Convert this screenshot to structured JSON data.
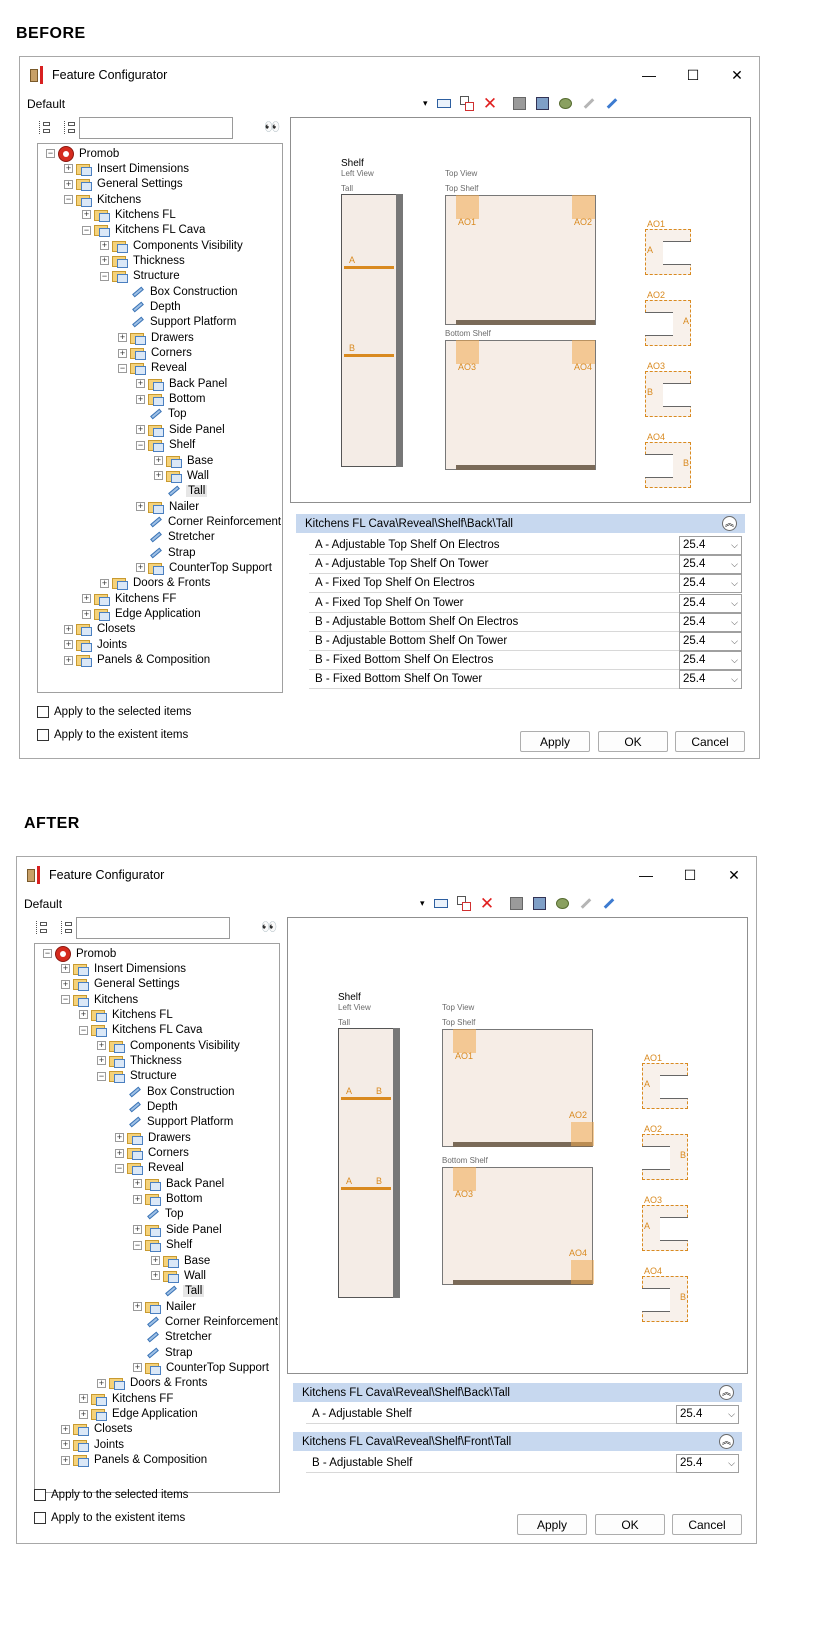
{
  "headings": {
    "before": "BEFORE",
    "after": "AFTER"
  },
  "window": {
    "title": "Feature Configurator",
    "controls": {
      "minimize": "—",
      "maximize": "☐",
      "close": "✕"
    }
  },
  "toolbar": {
    "profile": "Default",
    "dropdown_arrow": "▾"
  },
  "tree": {
    "search_icon": "👀",
    "rows": [
      {
        "label": "Promob",
        "depth": 0,
        "expander": "−",
        "icon": "root"
      },
      {
        "label": "Insert Dimensions",
        "depth": 1,
        "expander": "+",
        "icon": "folder"
      },
      {
        "label": "General Settings",
        "depth": 1,
        "expander": "+",
        "icon": "folder"
      },
      {
        "label": "Kitchens",
        "depth": 1,
        "expander": "−",
        "icon": "folder"
      },
      {
        "label": "Kitchens FL",
        "depth": 2,
        "expander": "+",
        "icon": "folder"
      },
      {
        "label": "Kitchens FL Cava",
        "depth": 2,
        "expander": "−",
        "icon": "folder"
      },
      {
        "label": "Components Visibility",
        "depth": 3,
        "expander": "+",
        "icon": "folder"
      },
      {
        "label": "Thickness",
        "depth": 3,
        "expander": "+",
        "icon": "folder"
      },
      {
        "label": "Structure",
        "depth": 3,
        "expander": "−",
        "icon": "folder"
      },
      {
        "label": "Box Construction",
        "depth": 4,
        "expander": "",
        "icon": "leaf"
      },
      {
        "label": "Depth",
        "depth": 4,
        "expander": "",
        "icon": "leaf"
      },
      {
        "label": "Support Platform",
        "depth": 4,
        "expander": "",
        "icon": "leaf"
      },
      {
        "label": "Drawers",
        "depth": 4,
        "expander": "+",
        "icon": "folder"
      },
      {
        "label": "Corners",
        "depth": 4,
        "expander": "+",
        "icon": "folder"
      },
      {
        "label": "Reveal",
        "depth": 4,
        "expander": "−",
        "icon": "folder"
      },
      {
        "label": "Back Panel",
        "depth": 5,
        "expander": "+",
        "icon": "folder"
      },
      {
        "label": "Bottom",
        "depth": 5,
        "expander": "+",
        "icon": "folder"
      },
      {
        "label": "Top",
        "depth": 5,
        "expander": "",
        "icon": "leaf"
      },
      {
        "label": "Side Panel",
        "depth": 5,
        "expander": "+",
        "icon": "folder"
      },
      {
        "label": "Shelf",
        "depth": 5,
        "expander": "−",
        "icon": "folder"
      },
      {
        "label": "Base",
        "depth": 6,
        "expander": "+",
        "icon": "folder"
      },
      {
        "label": "Wall",
        "depth": 6,
        "expander": "+",
        "icon": "folder"
      },
      {
        "label": "Tall",
        "depth": 6,
        "expander": "",
        "icon": "leaf",
        "selected": true
      },
      {
        "label": "Nailer",
        "depth": 5,
        "expander": "+",
        "icon": "folder"
      },
      {
        "label": "Corner Reinforcement",
        "depth": 5,
        "expander": "",
        "icon": "leaf"
      },
      {
        "label": "Stretcher",
        "depth": 5,
        "expander": "",
        "icon": "leaf"
      },
      {
        "label": "Strap",
        "depth": 5,
        "expander": "",
        "icon": "leaf"
      },
      {
        "label": "CounterTop Support",
        "depth": 5,
        "expander": "+",
        "icon": "folder"
      },
      {
        "label": "Doors & Fronts",
        "depth": 3,
        "expander": "+",
        "icon": "folder"
      },
      {
        "label": "Kitchens FF",
        "depth": 2,
        "expander": "+",
        "icon": "folder"
      },
      {
        "label": "Edge Application",
        "depth": 2,
        "expander": "+",
        "icon": "folder"
      },
      {
        "label": "Closets",
        "depth": 1,
        "expander": "+",
        "icon": "folder"
      },
      {
        "label": "Joints",
        "depth": 1,
        "expander": "+",
        "icon": "folder"
      },
      {
        "label": "Panels & Composition",
        "depth": 1,
        "expander": "+",
        "icon": "folder"
      }
    ]
  },
  "preview": {
    "shelf": "Shelf",
    "left_view": "Left View",
    "tall": "Tall",
    "top_view": "Top View",
    "top_shelf": "Top Shelf",
    "bottom_shelf": "Bottom Shelf",
    "a": "A",
    "b": "B",
    "ao1": "AO1",
    "ao2": "AO2",
    "ao3": "AO3",
    "ao4": "AO4"
  },
  "before": {
    "sections": [
      {
        "header": "Kitchens FL Cava\\Reveal\\Shelf\\Back\\Tall",
        "rows": [
          {
            "label": "A - Adjustable Top Shelf On Electros",
            "value": "25.4"
          },
          {
            "label": "A - Adjustable Top Shelf On Tower",
            "value": "25.4"
          },
          {
            "label": "A - Fixed Top Shelf On Electros",
            "value": "25.4"
          },
          {
            "label": "A - Fixed Top Shelf On Tower",
            "value": "25.4"
          },
          {
            "label": "B - Adjustable Bottom Shelf On Electros",
            "value": "25.4"
          },
          {
            "label": "B - Adjustable Bottom Shelf On Tower",
            "value": "25.4"
          },
          {
            "label": "B - Fixed Bottom Shelf On Electros",
            "value": "25.4"
          },
          {
            "label": "B - Fixed Bottom Shelf On Tower",
            "value": "25.4"
          }
        ]
      }
    ]
  },
  "after": {
    "sections": [
      {
        "header": "Kitchens FL Cava\\Reveal\\Shelf\\Back\\Tall",
        "rows": [
          {
            "label": "A - Adjustable Shelf",
            "value": "25.4"
          }
        ]
      },
      {
        "header": "Kitchens FL Cava\\Reveal\\Shelf\\Front\\Tall",
        "rows": [
          {
            "label": "B - Adjustable Shelf",
            "value": "25.4"
          }
        ]
      }
    ]
  },
  "options": {
    "apply_selected": "Apply to the selected items",
    "apply_existent": "Apply to the existent items"
  },
  "buttons": {
    "apply": "Apply",
    "ok": "OK",
    "cancel": "Cancel"
  },
  "icons": {
    "collapse": "chevrons-up-icon",
    "dropdown": "chevron-down-icon",
    "delete": "red-x-icon"
  },
  "colors": {
    "accent_orange": "#d98a20",
    "section_header": "#c7d8ef",
    "delete_red": "#e02020"
  }
}
